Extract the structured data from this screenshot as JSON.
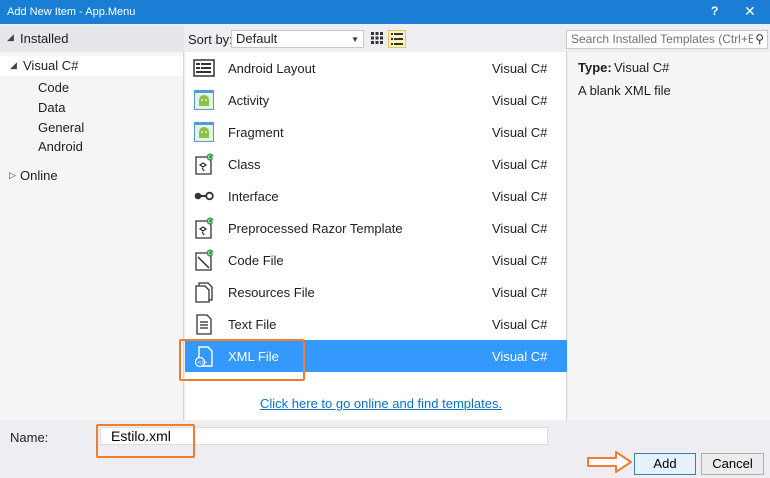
{
  "window": {
    "title": "Add New Item - App.Menu",
    "help": "?",
    "close": "✕"
  },
  "tree": {
    "header": "Installed",
    "root": "Visual C#",
    "children": [
      "Code",
      "Data",
      "General",
      "Android"
    ],
    "online": "Online"
  },
  "toolbar": {
    "sort_label": "Sort by:",
    "sort_value": "Default",
    "search_placeholder": "Search Installed Templates (Ctrl+E)"
  },
  "templates": [
    {
      "name": "Android Layout",
      "type": "Visual C#",
      "icon": "android-layout-icon"
    },
    {
      "name": "Activity",
      "type": "Visual C#",
      "icon": "android-activity-icon"
    },
    {
      "name": "Fragment",
      "type": "Visual C#",
      "icon": "android-fragment-icon"
    },
    {
      "name": "Class",
      "type": "Visual C#",
      "icon": "class-icon"
    },
    {
      "name": "Interface",
      "type": "Visual C#",
      "icon": "interface-icon"
    },
    {
      "name": "Preprocessed Razor Template",
      "type": "Visual C#",
      "icon": "razor-template-icon"
    },
    {
      "name": "Code File",
      "type": "Visual C#",
      "icon": "code-file-icon"
    },
    {
      "name": "Resources File",
      "type": "Visual C#",
      "icon": "resources-file-icon"
    },
    {
      "name": "Text File",
      "type": "Visual C#",
      "icon": "text-file-icon"
    },
    {
      "name": "XML File",
      "type": "Visual C#",
      "icon": "xml-file-icon",
      "selected": true
    }
  ],
  "online_link": "Click here to go online and find templates.",
  "details": {
    "type_label": "Type:",
    "type_value": "Visual C#",
    "description": "A blank XML file"
  },
  "bottom": {
    "name_label": "Name:",
    "name_value": "Estilo.xml",
    "add": "Add",
    "cancel": "Cancel"
  },
  "colors": {
    "titlebar": "#1a7fd4",
    "selection": "#3399ff",
    "annotation": "#ee7d31",
    "link": "#0e70c0"
  }
}
